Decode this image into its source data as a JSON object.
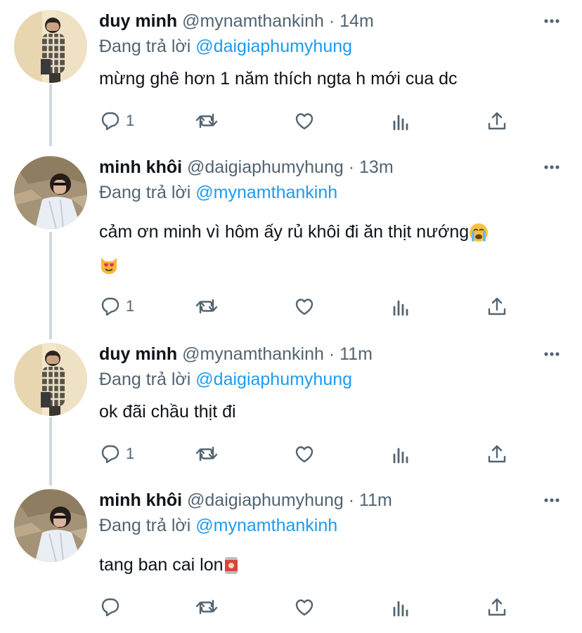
{
  "tweets": [
    {
      "name": "duy minh",
      "handle": "@mynamthankinh",
      "separator": "·",
      "time": "14m",
      "replying_label": "Đang trả lời",
      "replying_to": "@daigiaphumyhung",
      "text_lines": [
        "mừng ghê hơn 1 năm thích ngta h mới cua dc"
      ],
      "reply_count": "1",
      "avatar": "avatar-duy-minh"
    },
    {
      "name": "minh khôi",
      "handle": "@daigiaphumyhung",
      "separator": "·",
      "time": "13m",
      "replying_label": "Đang trả lời",
      "replying_to": "@mynamthankinh",
      "text_lines": [
        "cảm ơn minh vì hôm ấy rủ khôi đi ăn thịt nướng"
      ],
      "emojis": [
        "crying-face-emoji",
        "heart-eyes-cat-emoji"
      ],
      "reply_count": "1",
      "avatar": "avatar-minh-khoi"
    },
    {
      "name": "duy minh",
      "handle": "@mynamthankinh",
      "separator": "·",
      "time": "11m",
      "replying_label": "Đang trả lời",
      "replying_to": "@daigiaphumyhung",
      "text_lines": [
        "ok đãi chầu thịt đi"
      ],
      "reply_count": "1",
      "avatar": "avatar-duy-minh"
    },
    {
      "name": "minh khôi",
      "handle": "@daigiaphumyhung",
      "separator": "·",
      "time": "11m",
      "replying_label": "Đang trả lời",
      "replying_to": "@mynamthankinh",
      "text_lines": [
        "tang ban cai lon"
      ],
      "emojis": [
        "can-emoji"
      ],
      "reply_count": "",
      "avatar": "avatar-minh-khoi"
    }
  ],
  "colors": {
    "name": "#0f1419",
    "secondary": "#536471",
    "mention": "#1d9bf0",
    "thread_line": "#cfd9de"
  },
  "icons": [
    "reply-icon",
    "retweet-icon",
    "like-icon",
    "analytics-icon",
    "share-icon",
    "more-icon"
  ]
}
